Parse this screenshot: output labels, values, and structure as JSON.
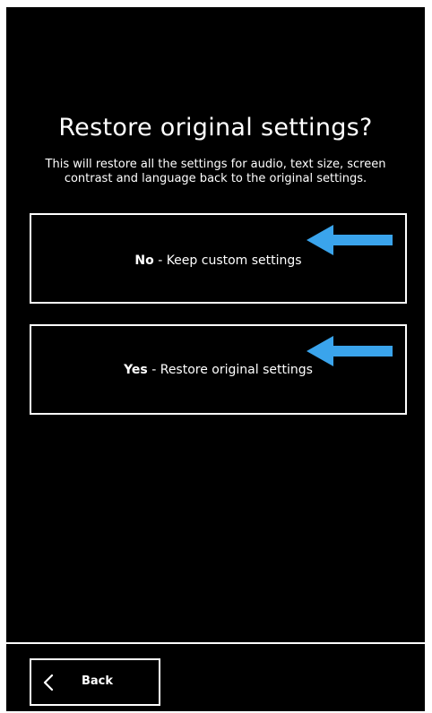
{
  "dialog": {
    "title": "Restore original settings?",
    "description": "This will restore all the settings for audio, text size, screen contrast and language back to the original settings."
  },
  "options": [
    {
      "bold": "No",
      "rest": " - Keep custom settings",
      "icon": "arrow-left-icon"
    },
    {
      "bold": "Yes",
      "rest": " - Restore original settings",
      "icon": "arrow-left-icon"
    }
  ],
  "footer": {
    "back_label": "Back",
    "back_icon": "chevron-left-icon"
  },
  "colors": {
    "background": "#000000",
    "foreground": "#ffffff",
    "annotation_arrow": "#3aa4ec"
  }
}
